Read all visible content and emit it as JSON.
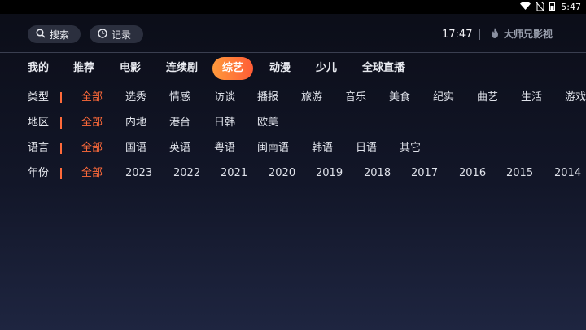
{
  "status_bar": {
    "time": "5:47"
  },
  "header": {
    "search_label": "搜索",
    "record_label": "记录",
    "clock": "17:47",
    "brand": "大师兄影视"
  },
  "tabs": [
    {
      "label": "我的"
    },
    {
      "label": "推荐"
    },
    {
      "label": "电影"
    },
    {
      "label": "连续剧"
    },
    {
      "label": "综艺",
      "active": true
    },
    {
      "label": "动漫"
    },
    {
      "label": "少儿"
    },
    {
      "label": "全球直播"
    }
  ],
  "filters": [
    {
      "label": "类型",
      "options": [
        "全部",
        "选秀",
        "情感",
        "访谈",
        "播报",
        "旅游",
        "音乐",
        "美食",
        "纪实",
        "曲艺",
        "生活",
        "游戏"
      ],
      "selected": 0
    },
    {
      "label": "地区",
      "options": [
        "全部",
        "内地",
        "港台",
        "日韩",
        "欧美"
      ],
      "selected": 0
    },
    {
      "label": "语言",
      "options": [
        "全部",
        "国语",
        "英语",
        "粤语",
        "闽南语",
        "韩语",
        "日语",
        "其它"
      ],
      "selected": 0
    },
    {
      "label": "年份",
      "options": [
        "全部",
        "2023",
        "2022",
        "2021",
        "2020",
        "2019",
        "2018",
        "2017",
        "2016",
        "2015",
        "2014"
      ],
      "selected": 0
    }
  ],
  "colors": {
    "accent": "#ff6a3a",
    "tab_gradient_start": "#ff9a3c",
    "tab_gradient_end": "#ff5c36"
  }
}
